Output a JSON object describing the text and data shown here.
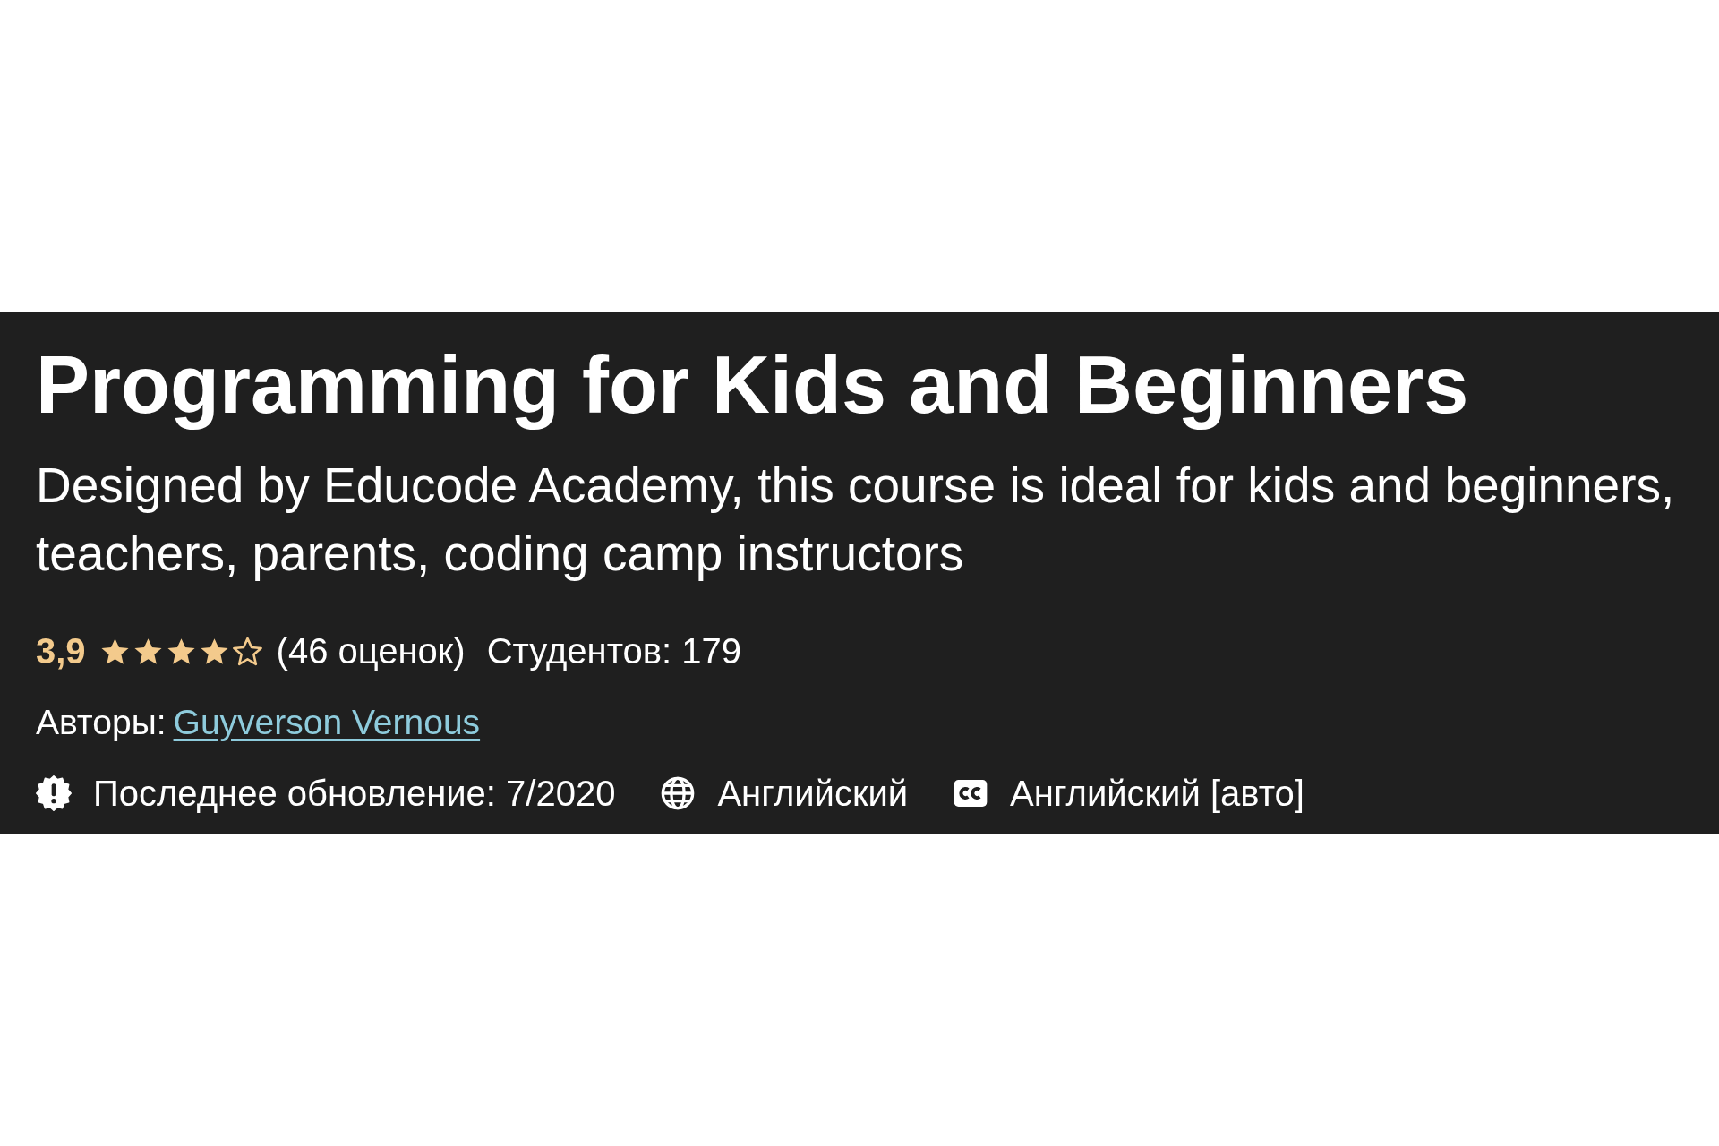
{
  "course": {
    "title": "Programming for Kids and Beginners",
    "subtitle": "Designed by Educode Academy, this course is ideal for kids and beginners, teachers, parents, coding camp instructors",
    "rating": {
      "score": "3,9",
      "stars": 4,
      "count": "(46 оценок)"
    },
    "students": "Студентов: 179",
    "authors": {
      "label": "Авторы:",
      "names": [
        "Guyverson Vernous"
      ]
    },
    "meta": [
      {
        "kind": "update",
        "text": "Последнее обновление: 7/2020"
      },
      {
        "kind": "language",
        "text": "Английский"
      },
      {
        "kind": "captions",
        "text": "Английский [авто]"
      }
    ]
  }
}
